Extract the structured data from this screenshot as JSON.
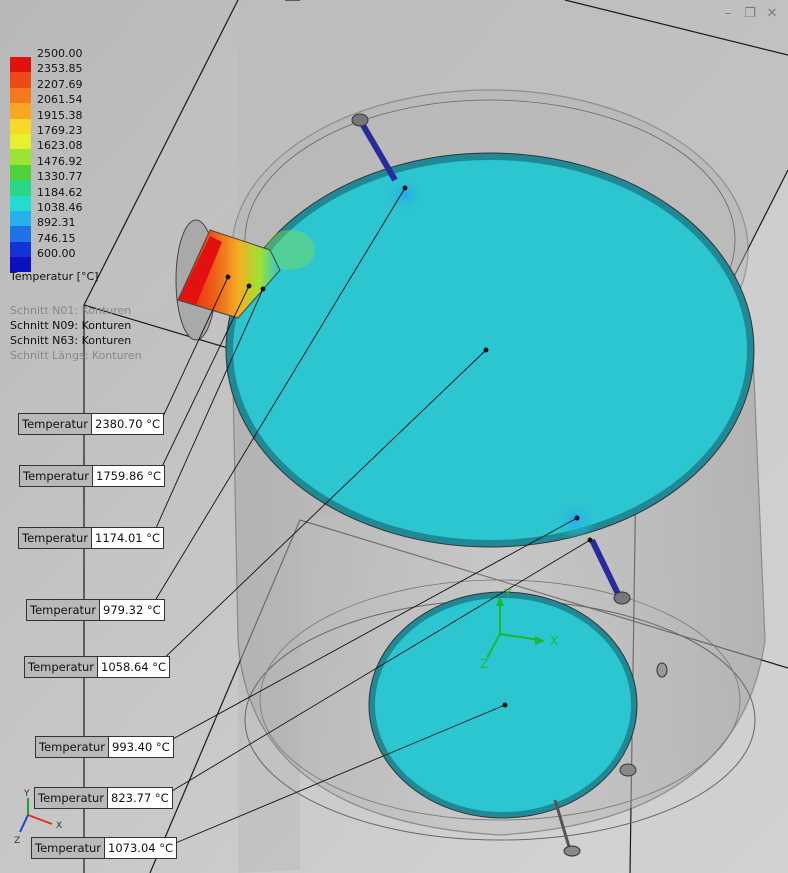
{
  "window": {
    "controls": [
      {
        "name": "minimize",
        "glyph": "–"
      },
      {
        "name": "restore",
        "glyph": "❐"
      },
      {
        "name": "close",
        "glyph": "✕"
      }
    ]
  },
  "legend": {
    "title": "Temperatur [°C]",
    "ticks": [
      "2500.00",
      "2353.85",
      "2207.69",
      "2061.54",
      "1915.38",
      "1769.23",
      "1623.08",
      "1476.92",
      "1330.77",
      "1184.62",
      "1038.46",
      "892.31",
      "746.15",
      "600.00"
    ],
    "colors": [
      "#e31010",
      "#ee4a16",
      "#f27a1c",
      "#f7a722",
      "#f7d92a",
      "#e6f02e",
      "#9ee234",
      "#4ed13a",
      "#28d88a",
      "#23dcd0",
      "#26b0ee",
      "#1e74e6",
      "#1432d8",
      "#0a10c0"
    ]
  },
  "sections": [
    {
      "label": "Schnitt N01: Konturen",
      "active": false
    },
    {
      "label": "Schnitt N09: Konturen",
      "active": true
    },
    {
      "label": "Schnitt N63: Konturen",
      "active": true
    },
    {
      "label": "Schnitt Längs: Konturen",
      "active": false
    }
  ],
  "probes": [
    {
      "label": "Temperatur",
      "value": "2380.70 °C"
    },
    {
      "label": "Temperatur",
      "value": "1759.86 °C"
    },
    {
      "label": "Temperatur",
      "value": "1174.01 °C"
    },
    {
      "label": "Temperatur",
      "value": "979.32 °C"
    },
    {
      "label": "Temperatur",
      "value": "1058.64 °C"
    },
    {
      "label": "Temperatur",
      "value": "993.40 °C"
    },
    {
      "label": "Temperatur",
      "value": "823.77 °C"
    },
    {
      "label": "Temperatur",
      "value": "1073.04 °C"
    }
  ],
  "axes": {
    "x": "X",
    "y": "Y",
    "z": "Z"
  },
  "triad": {
    "x": "X",
    "y": "Y",
    "z": "Z"
  },
  "colors": {
    "background": "#c9c9c9",
    "fluid": "#2cc6d0",
    "axis_x": "#19b832",
    "axis_y": "#19b832",
    "triad_x": "#e03020",
    "triad_y": "#20a030",
    "triad_z": "#2040d0"
  }
}
